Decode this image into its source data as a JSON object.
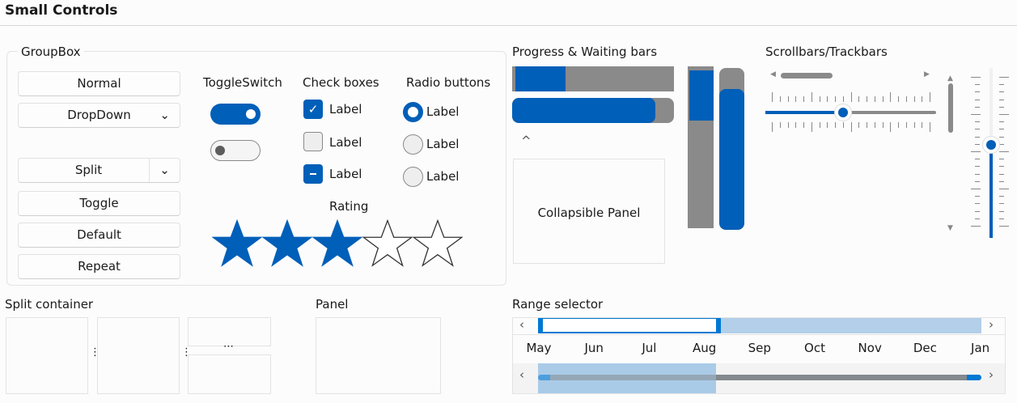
{
  "title": "Small Controls",
  "groupbox": {
    "label": "GroupBox",
    "buttons": {
      "normal": "Normal",
      "dropdown": "DropDown",
      "split": "Split",
      "toggle": "Toggle",
      "default": "Default",
      "repeat": "Repeat"
    },
    "toggle_switch": {
      "label": "ToggleSwitch",
      "states": [
        true,
        false
      ]
    },
    "check_boxes": {
      "label": "Check boxes",
      "items": [
        {
          "label": "Label",
          "state": "checked"
        },
        {
          "label": "Label",
          "state": "unchecked"
        },
        {
          "label": "Label",
          "state": "indeterminate"
        }
      ]
    },
    "radio_buttons": {
      "label": "Radio buttons",
      "items": [
        {
          "label": "Label",
          "selected": true
        },
        {
          "label": "Label",
          "selected": false
        },
        {
          "label": "Label",
          "selected": false
        }
      ]
    },
    "rating": {
      "label": "Rating",
      "value": 3,
      "max": 5
    }
  },
  "progress": {
    "label": "Progress & Waiting bars",
    "collapsible_panel": "Collapsible Panel",
    "bars": [
      0.3,
      0.88,
      0.33,
      0.87
    ]
  },
  "scroll": {
    "label": "Scrollbars/Trackbars",
    "h_trackbar_value": 0.45,
    "v_trackbar_value": 0.45
  },
  "split_container": {
    "label": "Split container"
  },
  "panel": {
    "label": "Panel"
  },
  "range_selector": {
    "label": "Range selector",
    "months": [
      "May",
      "Jun",
      "Jul",
      "Aug",
      "Sep",
      "Oct",
      "Nov",
      "Dec",
      "Jan"
    ],
    "selected_range": [
      "May",
      "Aug"
    ]
  },
  "colors": {
    "accent": "#005fb8",
    "track": "#8a8a8a",
    "selection": "#b3cfe9"
  }
}
